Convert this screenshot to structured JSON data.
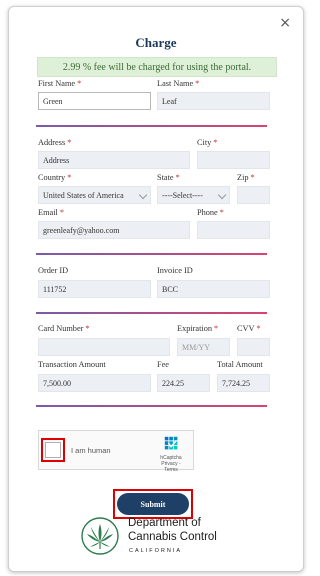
{
  "modal": {
    "title": "Charge",
    "close_glyph": "×",
    "fee_banner": "2.99 % fee will be charged for using the portal."
  },
  "required_marker": "*",
  "fields": {
    "first_name": {
      "label": "First Name",
      "value": "Green"
    },
    "last_name": {
      "label": "Last Name",
      "value": "Leaf"
    },
    "address": {
      "label": "Address",
      "value": "Address"
    },
    "city": {
      "label": "City",
      "value": ""
    },
    "country": {
      "label": "Country",
      "value": "United States of America"
    },
    "state": {
      "label": "State",
      "value": "----Select----"
    },
    "zip": {
      "label": "Zip",
      "value": ""
    },
    "email": {
      "label": "Email",
      "value": "greenleafy@yahoo.com"
    },
    "phone": {
      "label": "Phone",
      "value": ""
    },
    "order_id": {
      "label": "Order ID",
      "value": "111752"
    },
    "invoice_id": {
      "label": "Invoice ID",
      "value": "BCC"
    },
    "card_number": {
      "label": "Card Number",
      "value": ""
    },
    "expiration": {
      "label": "Expiration",
      "placeholder": "MM/YY"
    },
    "cvv": {
      "label": "CVV",
      "value": ""
    },
    "transaction_amount": {
      "label": "Transaction Amount",
      "value": "7,500.00"
    },
    "fee": {
      "label": "Fee",
      "value": "224.25"
    },
    "total_amount": {
      "label": "Total Amount",
      "value": "7,724.25"
    }
  },
  "captcha": {
    "label": "I am human",
    "brand": "hCaptcha",
    "links": "Privacy - Terms"
  },
  "submit_label": "Submit",
  "footer_logo": {
    "line1": "Department of",
    "line2": "Cannabis Control",
    "line3": "CALIFORNIA"
  },
  "colors": {
    "accent_navy": "#1e3f66",
    "banner_green": "#dff0d8",
    "required_red": "#c62828",
    "highlight_red": "#dd0000",
    "logo_green": "#2e7d4f"
  },
  "icons": [
    "close-icon",
    "chevron-down-icon",
    "hcaptcha-logo-icon",
    "cannabis-leaf-icon"
  ]
}
